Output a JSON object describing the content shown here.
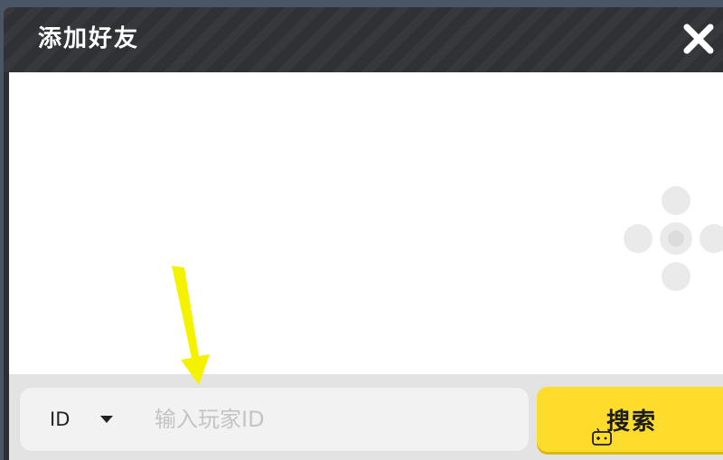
{
  "dialog": {
    "title": "添加好友",
    "close_icon": "close-icon"
  },
  "search": {
    "type_selected": "ID",
    "type_icon": "chevron-down-icon",
    "input_value": "",
    "input_placeholder": "输入玩家ID",
    "button_label": "搜索"
  },
  "decor": {
    "dpad_icon": "dpad-icon",
    "annotation_icon": "yellow-arrow-icon",
    "watermark_icon": "game-controller-icon"
  },
  "colors": {
    "header_bg": "#2f3135",
    "button_yellow": "#fddc2c",
    "arrow_yellow": "#f5f200"
  }
}
